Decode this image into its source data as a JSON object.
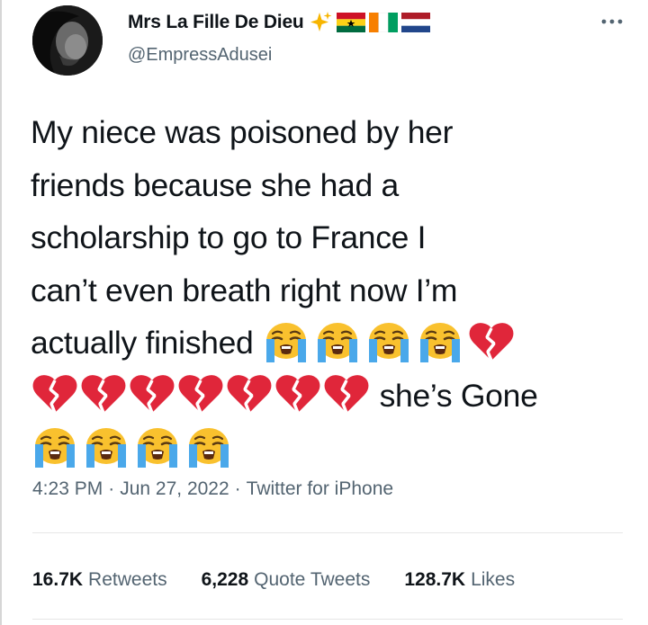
{
  "author": {
    "display_name": "Mrs La Fille De Dieu",
    "handle": "@EmpressAdusei",
    "badges": [
      "sparkles-icon",
      "ghana-flag-icon",
      "ivory-coast-flag-icon",
      "netherlands-flag-icon"
    ]
  },
  "tweet": {
    "text_lines": [
      "My niece was poisoned by her",
      "friends because she had a",
      "scholarship to go to France I",
      "can’t even breath right now I’m",
      "actually finished"
    ],
    "text_tail": "she’s Gone",
    "emoji_line5": [
      "loudly-crying-face",
      "loudly-crying-face",
      "loudly-crying-face",
      "loudly-crying-face",
      "broken-heart"
    ],
    "emoji_line6": [
      "broken-heart",
      "broken-heart",
      "broken-heart",
      "broken-heart",
      "broken-heart",
      "broken-heart",
      "broken-heart"
    ],
    "emoji_line7": [
      "loudly-crying-face",
      "loudly-crying-face",
      "loudly-crying-face",
      "loudly-crying-face"
    ]
  },
  "meta": {
    "time": "4:23 PM",
    "sep1": "·",
    "date": "Jun 27, 2022",
    "sep2": "·",
    "source": "Twitter for iPhone"
  },
  "stats": {
    "retweets_count": "16.7K",
    "retweets_label": "Retweets",
    "quotes_count": "6,228",
    "quotes_label": "Quote Tweets",
    "likes_count": "128.7K",
    "likes_label": "Likes"
  }
}
